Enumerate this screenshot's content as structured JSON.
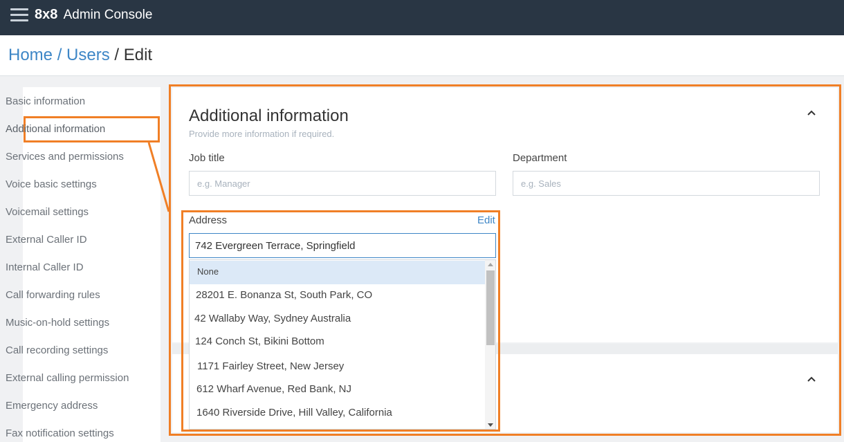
{
  "header": {
    "logo": "8x8",
    "app_name": "Admin Console"
  },
  "breadcrumb": {
    "home": "Home",
    "users": "Users",
    "current": "Edit",
    "separator": "/"
  },
  "sidebar": {
    "items": [
      {
        "label": "Basic information"
      },
      {
        "label": "Additional information",
        "active": true
      },
      {
        "label": "Services and permissions"
      },
      {
        "label": "Voice basic settings"
      },
      {
        "label": "Voicemail settings"
      },
      {
        "label": "External Caller ID"
      },
      {
        "label": "Internal Caller ID"
      },
      {
        "label": "Call forwarding rules"
      },
      {
        "label": "Music-on-hold settings"
      },
      {
        "label": "Call recording settings"
      },
      {
        "label": "External calling permission"
      },
      {
        "label": "Emergency address"
      },
      {
        "label": "Fax notification settings"
      }
    ]
  },
  "section": {
    "title": "Additional information",
    "subtitle": "Provide more information if required.",
    "job_title_label": "Job title",
    "job_title_placeholder": "e.g. Manager",
    "department_label": "Department",
    "department_placeholder": "e.g. Sales",
    "address_label": "Address",
    "address_edit": "Edit",
    "address_value": "742 Evergreen Terrace, Springfield"
  },
  "address_dropdown": {
    "options": [
      "None",
      "28201 E. Bonanza St, South Park, CO",
      "42 Wallaby Way, Sydney Australia",
      "124 Conch St, Bikini Bottom",
      "1171 Fairley Street, New Jersey",
      "612 Wharf Avenue, Red Bank, NJ",
      "1640 Riverside Drive, Hill Valley, California"
    ],
    "highlighted": "None"
  },
  "colors": {
    "topbar": "#293644",
    "link": "#3d86c6",
    "annotation": "#f07f26",
    "highlight": "#dce9f7"
  }
}
